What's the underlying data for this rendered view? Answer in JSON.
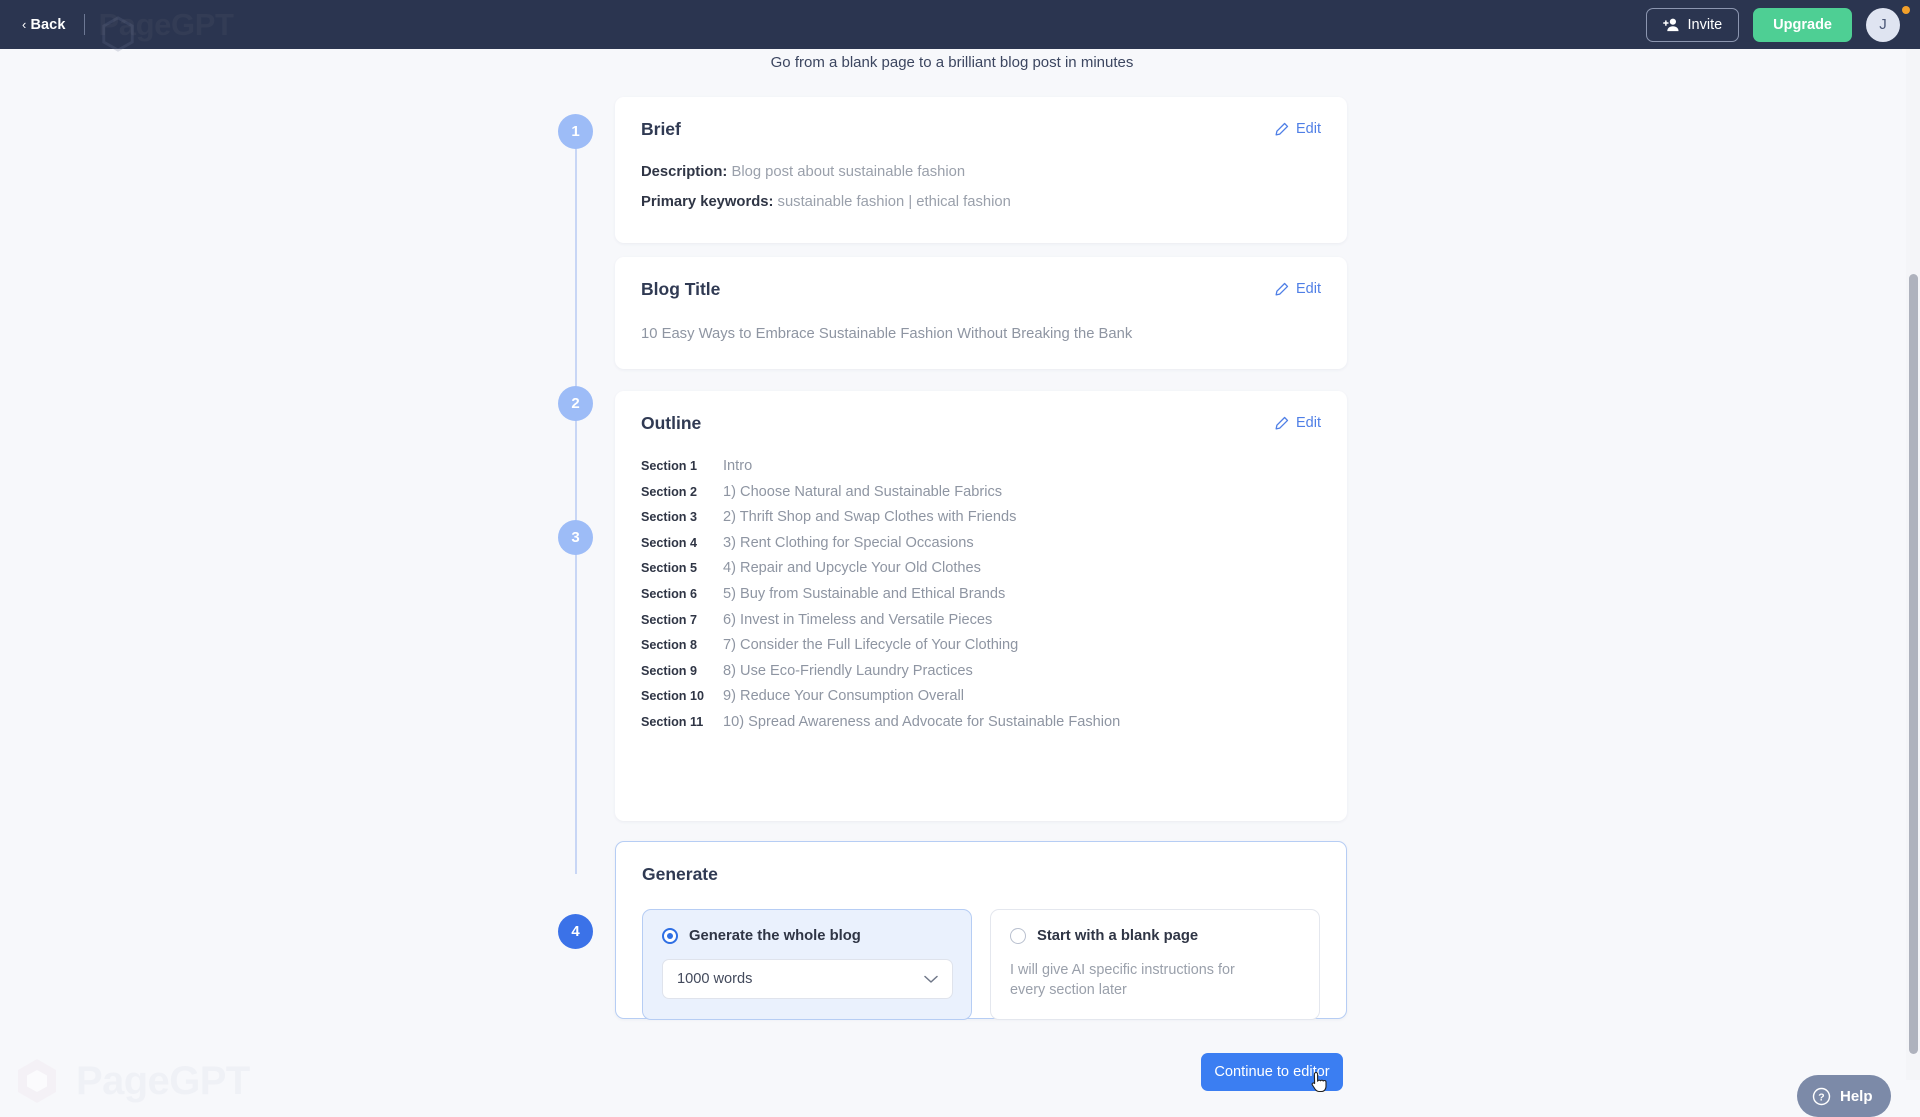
{
  "topbar": {
    "back_label": "Back",
    "back_chevron": "‹",
    "brand": "PageGPT",
    "invite_label": "Invite",
    "upgrade_label": "Upgrade",
    "avatar_initial": "J"
  },
  "tagline": "Go from a blank page to a brilliant blog post in minutes",
  "watermark": {
    "text": "PageGPT"
  },
  "steps": [
    {
      "number": "1"
    },
    {
      "number": "2"
    },
    {
      "number": "3"
    },
    {
      "number": "4"
    }
  ],
  "cards": {
    "brief": {
      "title": "Brief",
      "edit_label": "Edit",
      "description_label": "Description:",
      "description_value": "Blog post about sustainable fashion",
      "keywords_label": "Primary keywords:",
      "keywords_value": "sustainable fashion | ethical fashion"
    },
    "blog_title": {
      "title": "Blog Title",
      "edit_label": "Edit",
      "value": "10 Easy Ways to Embrace Sustainable Fashion Without Breaking the Bank"
    },
    "outline": {
      "title": "Outline",
      "edit_label": "Edit",
      "rows": [
        {
          "label": "Section 1",
          "text": "Intro"
        },
        {
          "label": "Section 2",
          "text": "1) Choose Natural and Sustainable Fabrics"
        },
        {
          "label": "Section 3",
          "text": "2) Thrift Shop and Swap Clothes with Friends"
        },
        {
          "label": "Section 4",
          "text": "3) Rent Clothing for Special Occasions"
        },
        {
          "label": "Section 5",
          "text": "4) Repair and Upcycle Your Old Clothes"
        },
        {
          "label": "Section 6",
          "text": "5) Buy from Sustainable and Ethical Brands"
        },
        {
          "label": "Section 7",
          "text": "6) Invest in Timeless and Versatile Pieces"
        },
        {
          "label": "Section 8",
          "text": "7) Consider the Full Lifecycle of Your Clothing"
        },
        {
          "label": "Section 9",
          "text": "8) Use Eco-Friendly Laundry Practices"
        },
        {
          "label": "Section 10",
          "text": "9) Reduce Your Consumption Overall"
        },
        {
          "label": "Section 11",
          "text": "10) Spread Awareness and Advocate for Sustainable Fashion"
        }
      ]
    },
    "generate": {
      "title": "Generate",
      "option_whole": {
        "label": "Generate the whole blog",
        "selected": true,
        "word_count_value": "1000 words"
      },
      "option_blank": {
        "label": "Start with a blank page",
        "selected": false,
        "description": "I will give AI specific instructions for every section later"
      }
    }
  },
  "continue_button": "Continue to editor",
  "help_widget": {
    "label": "Help"
  }
}
